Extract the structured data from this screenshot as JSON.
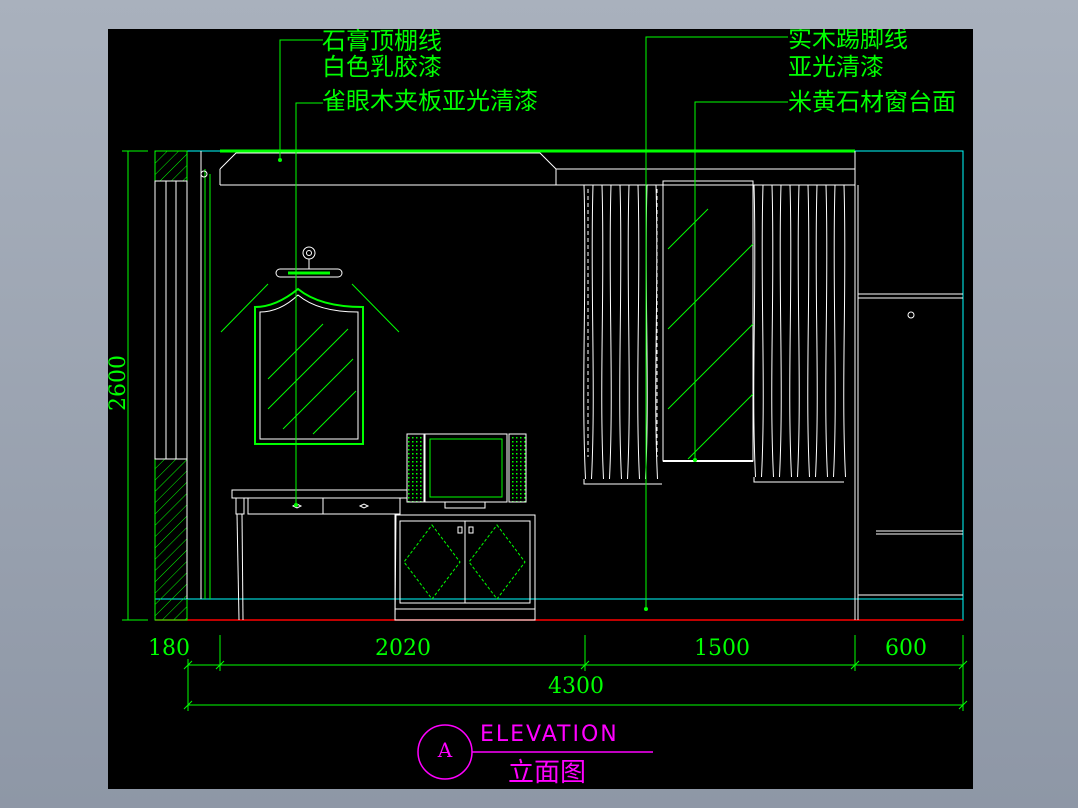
{
  "annotations": {
    "ceiling_line": "石膏顶棚线",
    "ceiling_finish": "白色乳胶漆",
    "veneer_finish": "雀眼木夹板亚光清漆",
    "skirting": "实木踢脚线",
    "skirting_finish": "亚光清漆",
    "sill": "米黄石材窗台面"
  },
  "dimensions": {
    "height": "2600",
    "seg_wall": "180",
    "seg_desk": "2020",
    "seg_window": "1500",
    "seg_wardrobe": "600",
    "total": "4300"
  },
  "title": {
    "tag": "A",
    "english": "ELEVATION",
    "chinese": "立面图"
  },
  "colors": {
    "line_white": "#ffffff",
    "line_green": "#00ff00",
    "line_cyan": "#00ffff",
    "floor_red": "#ff0000",
    "title_magenta": "#ff00ff",
    "frame": "#a9b1bd"
  }
}
